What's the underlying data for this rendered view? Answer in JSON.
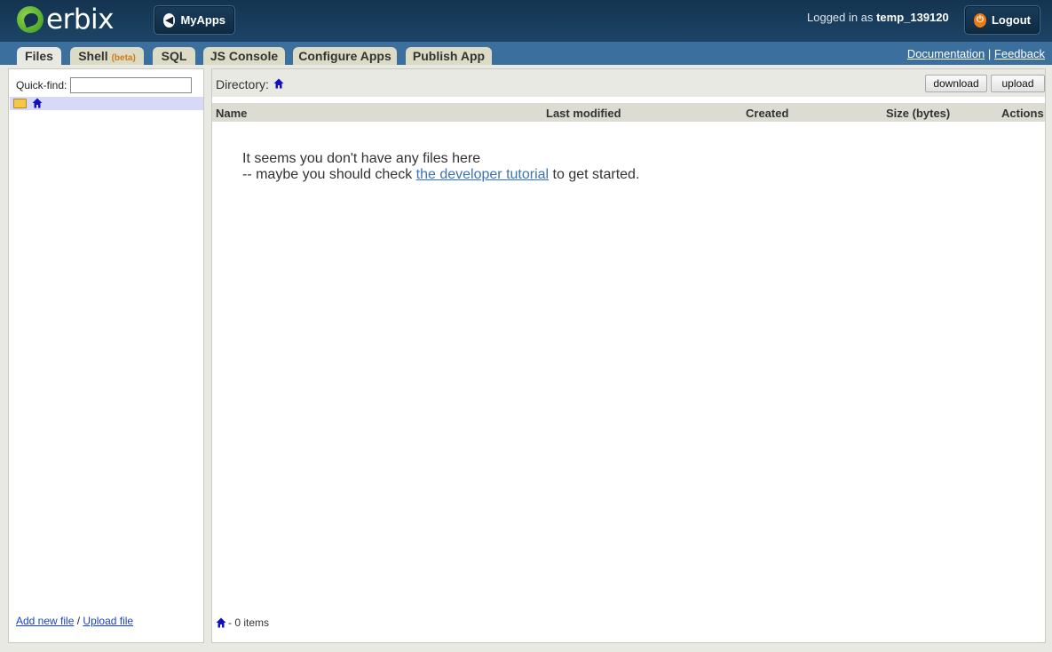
{
  "header": {
    "logo_text": "erbix",
    "myapps_label": "MyApps",
    "logged_prefix": "Logged in as",
    "username": "temp_139120",
    "logout_label": "Logout"
  },
  "tabs": [
    {
      "label": "Files"
    },
    {
      "label": "Shell",
      "badge": "(beta)"
    },
    {
      "label": "SQL"
    },
    {
      "label": "JS Console"
    },
    {
      "label": "Configure Apps"
    },
    {
      "label": "Publish App"
    }
  ],
  "toplinks": {
    "documentation": "Documentation",
    "separator": "|",
    "feedback": "Feedback"
  },
  "sidebar": {
    "quickfind_label": "Quick-find:",
    "quickfind_value": "",
    "add_new_file": "Add new file",
    "separator": "/",
    "upload_file": "Upload file"
  },
  "main": {
    "directory_label": "Directory:",
    "download_label": "download",
    "upload_label": "upload",
    "columns": [
      "Name",
      "Last modified",
      "Created",
      "Size (bytes)",
      "Actions"
    ],
    "empty_line1": "It seems you don't have any files here",
    "empty_line2_prefix": "-- maybe you should check",
    "empty_link": "the developer tutorial",
    "empty_line2_suffix": "to get started.",
    "status": "- 0 items"
  },
  "colors": {
    "header_bg": "#143450",
    "tabbar_bg": "#3a6f9e",
    "tab_bg": "#dcdcc6",
    "link": "#1a3fc8",
    "beta": "#d17a1a",
    "selected_row": "#d8d8f8"
  }
}
